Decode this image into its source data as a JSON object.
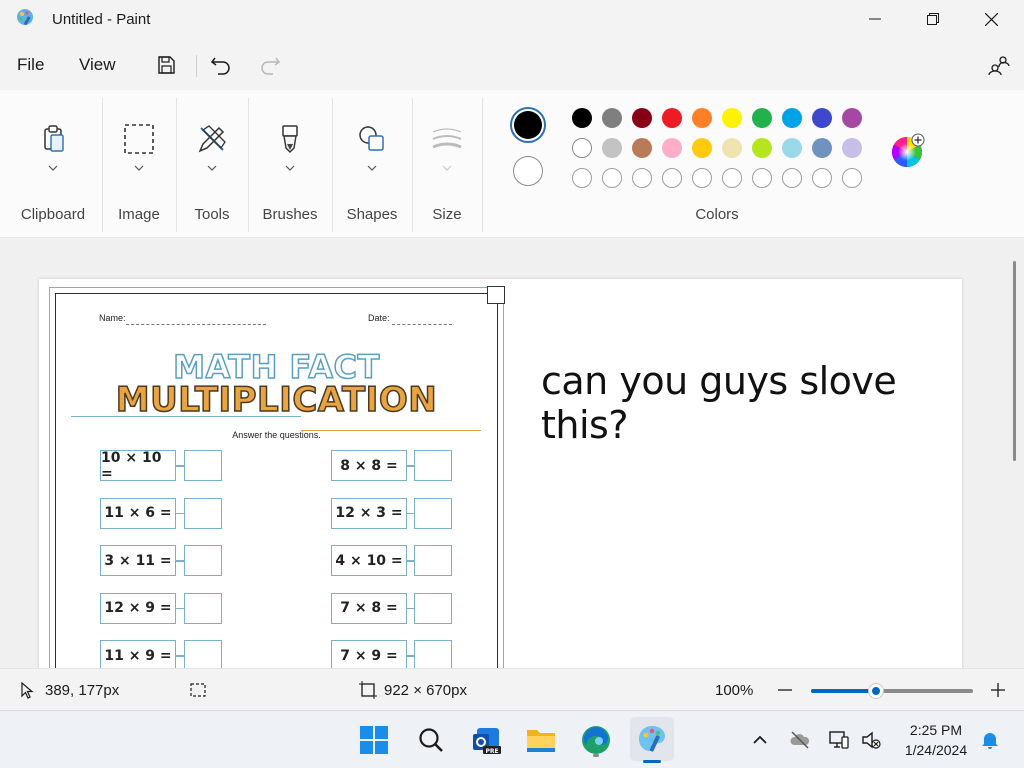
{
  "window": {
    "title": "Untitled - Paint"
  },
  "menu": {
    "file": "File",
    "view": "View"
  },
  "ribbon": {
    "groups": {
      "clipboard": "Clipboard",
      "image": "Image",
      "tools": "Tools",
      "brushes": "Brushes",
      "shapes": "Shapes",
      "size": "Size",
      "colors": "Colors"
    },
    "primary_color": "#000000",
    "secondary_color": "#ffffff",
    "palette_row1": [
      "#000000",
      "#7f7f7f",
      "#880015",
      "#ed1c24",
      "#ff7f27",
      "#fff200",
      "#22b14c",
      "#00a2e8",
      "#3f48cc",
      "#a349a4"
    ],
    "palette_row2": [
      "#ffffff",
      "#c3c3c3",
      "#b97a57",
      "#ffaec9",
      "#ffc90e",
      "#efe4b0",
      "#b5e61d",
      "#99d9ea",
      "#7092be",
      "#c8bfe7"
    ]
  },
  "worksheet": {
    "name_label": "Name:",
    "date_label": "Date:",
    "title_line1": "MATH FACT",
    "title_line2": "MULTIPLICATION",
    "instruction": "Answer the questions.",
    "left_column": [
      "10 × 10 =",
      "11 × 6 =",
      "3 × 11 =",
      "12 × 9 =",
      "11 × 9 ="
    ],
    "right_column": [
      "8 × 8 =",
      "12 × 3 =",
      "4 × 10 =",
      "7 × 8 =",
      "7 × 9 ="
    ]
  },
  "canvas_text": "can you guys slove this?",
  "status": {
    "cursor_position": "389, 177px",
    "canvas_size": "922 × 670px",
    "zoom": "100%",
    "zoom_level_percent": 40
  },
  "taskbar": {
    "time": "2:25 PM",
    "date": "1/24/2024"
  }
}
